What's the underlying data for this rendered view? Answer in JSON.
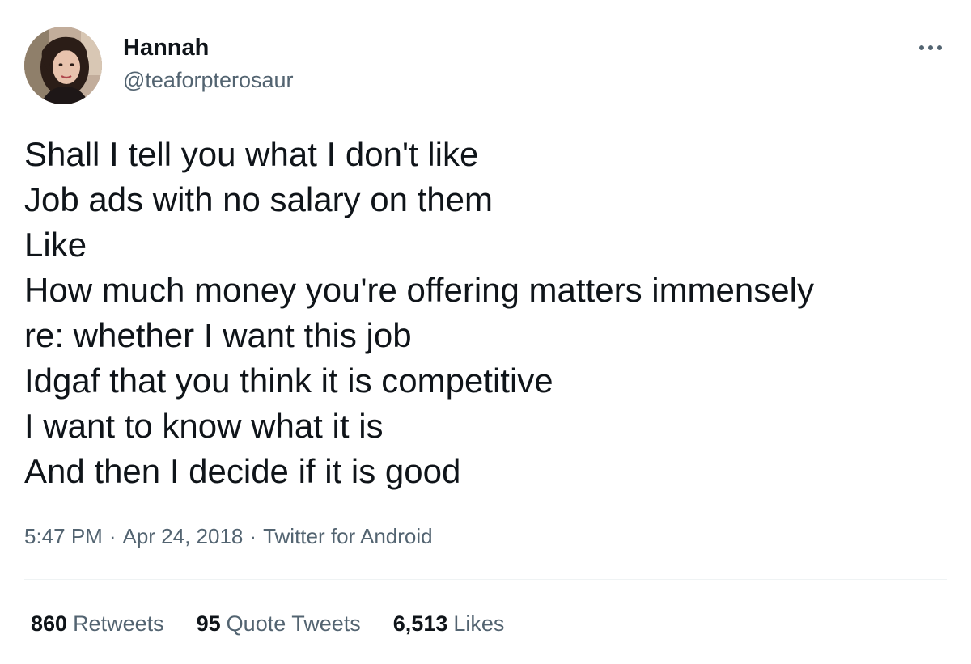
{
  "tweet": {
    "author": {
      "name": "Hannah",
      "handle": "@teaforpterosaur",
      "avatar_icon": "profile-photo"
    },
    "more_icon": "more-horizontal-icon",
    "text_lines": [
      "Shall I tell you what I don't like",
      "Job ads with no salary on them",
      "Like",
      "How much money you're offering matters immensely",
      "re: whether I want this job",
      "Idgaf that you think it is competitive",
      "I want to know what it is",
      "And then I decide if it is good"
    ],
    "meta": {
      "time": "5:47 PM",
      "separator": "·",
      "date": "Apr 24, 2018",
      "source": "Twitter for Android"
    },
    "stats": {
      "retweets": {
        "count": "860",
        "label": "Retweets"
      },
      "quote_tweets": {
        "count": "95",
        "label": "Quote Tweets"
      },
      "likes": {
        "count": "6,513",
        "label": "Likes"
      }
    }
  },
  "colors": {
    "text_primary": "#0f1419",
    "text_secondary": "#536471",
    "divider": "#eff3f4",
    "background": "#ffffff"
  }
}
